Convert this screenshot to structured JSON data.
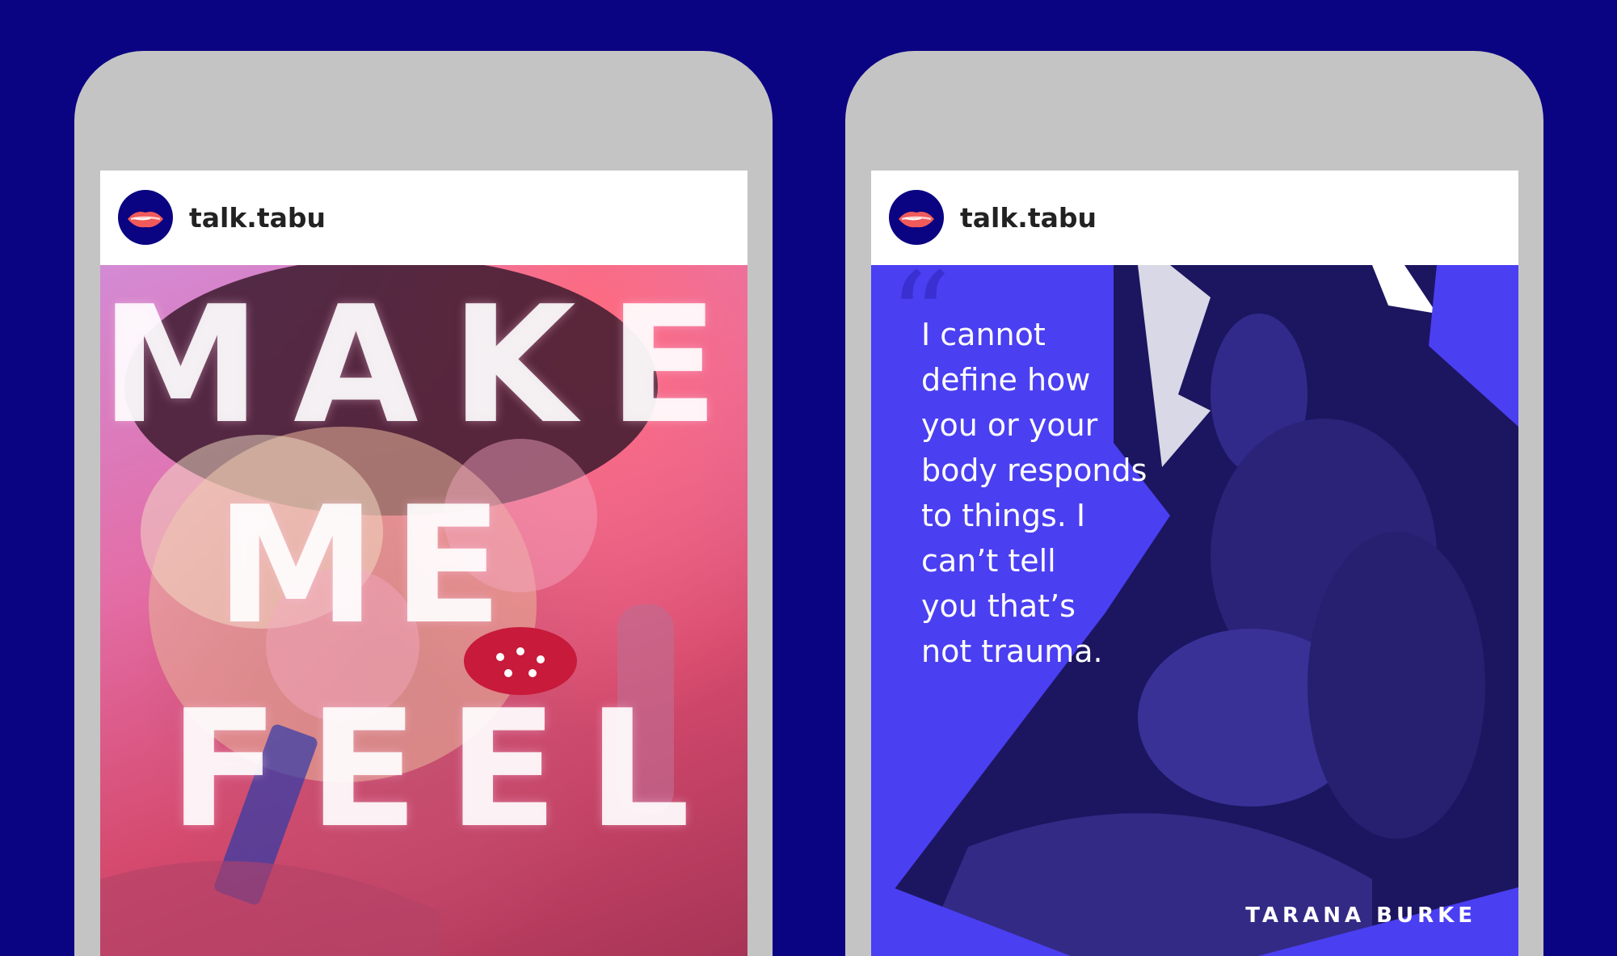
{
  "colors": {
    "background": "#0a0382",
    "phone_frame": "#c4c4c4",
    "header_bg": "#ffffff",
    "right_post_accent": "#4b3ff2",
    "avatar_bg": "#0a0382",
    "avatar_lips": "#f05a5a"
  },
  "posts": [
    {
      "username": "talk.tabu",
      "avatar_icon": "lips-icon",
      "headline_lines": [
        "MAKE",
        "ME",
        "FEEL"
      ]
    },
    {
      "username": "talk.tabu",
      "avatar_icon": "lips-icon",
      "quote_mark": "“",
      "quote_lines": [
        "I cannot",
        "define how",
        "you or your",
        "body responds",
        "to things. I",
        "can’t tell",
        "you that’s",
        "not trauma."
      ],
      "attribution": "TARANA BURKE"
    }
  ]
}
